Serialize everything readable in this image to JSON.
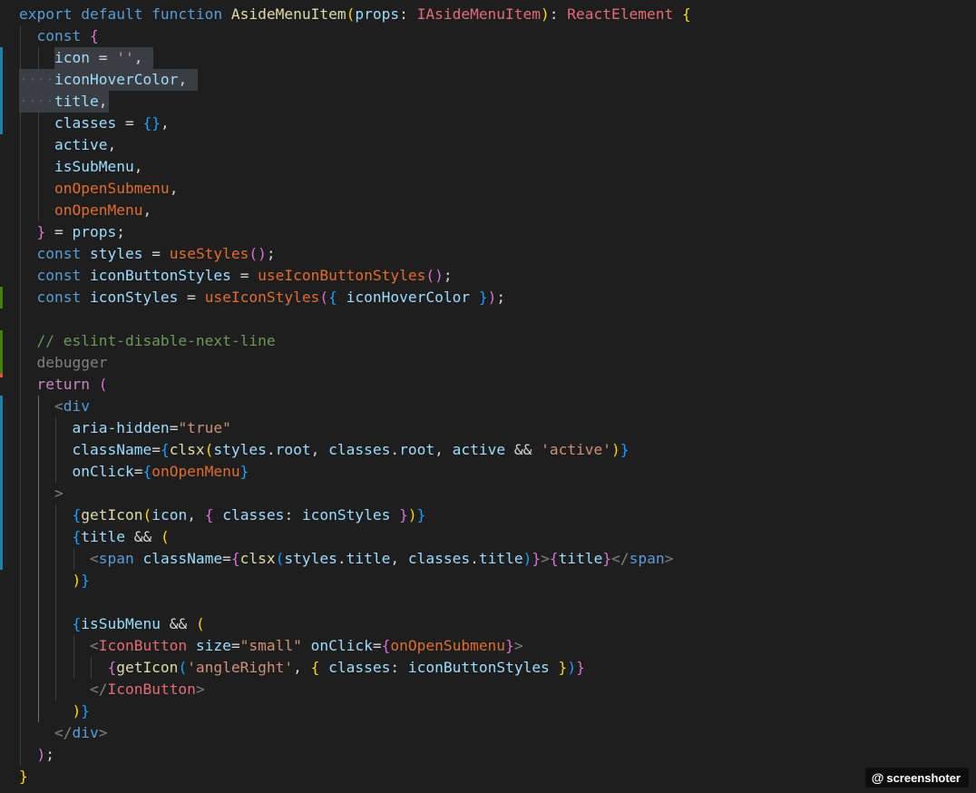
{
  "editor": {
    "background": "#1e1e1e",
    "theme_colors": {
      "keyword": "#569cd6",
      "control": "#c586c0",
      "function": "#dcdcaa",
      "function_alt": "#e06c2e",
      "variable": "#9cdcfe",
      "type": "#e06c75",
      "string": "#ce9178",
      "comment": "#6a9955",
      "punctuation": "#d4d4d4",
      "bracket_gold": "#ffd700",
      "bracket_pink": "#da70d6",
      "bracket_blue": "#179fff",
      "tag": "#808080",
      "component": "#4ec9b0",
      "inactive": "#808080"
    },
    "lines": [
      [
        [
          "export default function ",
          "keyword"
        ],
        [
          "AsideMenuItem",
          "function"
        ],
        [
          "(",
          "bracket_gold"
        ],
        [
          "props",
          "variable"
        ],
        [
          ": ",
          "punctuation"
        ],
        [
          "IAsideMenuItem",
          "type"
        ],
        [
          ")",
          "bracket_gold"
        ],
        [
          ": ",
          "punctuation"
        ],
        [
          "ReactElement",
          "type"
        ],
        [
          " {",
          "bracket_gold"
        ]
      ],
      [
        [
          "  const ",
          "keyword"
        ],
        [
          "{",
          "bracket_pink"
        ]
      ],
      [
        [
          "    icon",
          "variable"
        ],
        [
          " = ",
          "punctuation"
        ],
        [
          "''",
          "string"
        ],
        [
          ",",
          "punctuation"
        ]
      ],
      [
        [
          "    iconHoverColor",
          "variable"
        ],
        [
          ",",
          "punctuation"
        ]
      ],
      [
        [
          "    title",
          "variable"
        ],
        [
          ",",
          "punctuation"
        ]
      ],
      [
        [
          "    classes",
          "variable"
        ],
        [
          " = ",
          "punctuation"
        ],
        [
          "{}",
          "bracket_blue"
        ],
        [
          ",",
          "punctuation"
        ]
      ],
      [
        [
          "    active",
          "variable"
        ],
        [
          ",",
          "punctuation"
        ]
      ],
      [
        [
          "    isSubMenu",
          "variable"
        ],
        [
          ",",
          "punctuation"
        ]
      ],
      [
        [
          "    onOpenSubmenu",
          "function_alt"
        ],
        [
          ",",
          "punctuation"
        ]
      ],
      [
        [
          "    onOpenMenu",
          "function_alt"
        ],
        [
          ",",
          "punctuation"
        ]
      ],
      [
        [
          "  }",
          "bracket_pink"
        ],
        [
          " = ",
          "punctuation"
        ],
        [
          "props",
          "variable"
        ],
        [
          ";",
          "punctuation"
        ]
      ],
      [
        [
          "  const ",
          "keyword"
        ],
        [
          "styles",
          "variable"
        ],
        [
          " = ",
          "punctuation"
        ],
        [
          "useStyles",
          "function_alt"
        ],
        [
          "()",
          "bracket_pink"
        ],
        [
          ";",
          "punctuation"
        ]
      ],
      [
        [
          "  const ",
          "keyword"
        ],
        [
          "iconButtonStyles",
          "variable"
        ],
        [
          " = ",
          "punctuation"
        ],
        [
          "useIconButtonStyles",
          "function_alt"
        ],
        [
          "()",
          "bracket_pink"
        ],
        [
          ";",
          "punctuation"
        ]
      ],
      [
        [
          "  const ",
          "keyword"
        ],
        [
          "iconStyles",
          "variable"
        ],
        [
          " = ",
          "punctuation"
        ],
        [
          "useIconStyles",
          "function_alt"
        ],
        [
          "(",
          "bracket_pink"
        ],
        [
          "{ ",
          "bracket_blue"
        ],
        [
          "iconHoverColor",
          "variable"
        ],
        [
          " }",
          "bracket_blue"
        ],
        [
          ")",
          "bracket_pink"
        ],
        [
          ";",
          "punctuation"
        ]
      ],
      [],
      [
        [
          "  // eslint-disable-next-line",
          "comment"
        ]
      ],
      [
        [
          "  debugger",
          "inactive"
        ]
      ],
      [
        [
          "  return ",
          "control"
        ],
        [
          "(",
          "bracket_pink"
        ]
      ],
      [
        [
          "    <",
          "tag"
        ],
        [
          "div",
          "keyword"
        ]
      ],
      [
        [
          "      aria-hidden",
          "variable"
        ],
        [
          "=",
          "punctuation"
        ],
        [
          "\"true\"",
          "string"
        ]
      ],
      [
        [
          "      className",
          "variable"
        ],
        [
          "=",
          "punctuation"
        ],
        [
          "{",
          "bracket_blue"
        ],
        [
          "clsx",
          "function"
        ],
        [
          "(",
          "bracket_gold"
        ],
        [
          "styles",
          "variable"
        ],
        [
          ".",
          "punctuation"
        ],
        [
          "root",
          "variable"
        ],
        [
          ", ",
          "punctuation"
        ],
        [
          "classes",
          "variable"
        ],
        [
          ".",
          "punctuation"
        ],
        [
          "root",
          "variable"
        ],
        [
          ", ",
          "punctuation"
        ],
        [
          "active",
          "variable"
        ],
        [
          " && ",
          "punctuation"
        ],
        [
          "'active'",
          "string"
        ],
        [
          ")",
          "bracket_gold"
        ],
        [
          "}",
          "bracket_blue"
        ]
      ],
      [
        [
          "      onClick",
          "variable"
        ],
        [
          "=",
          "punctuation"
        ],
        [
          "{",
          "bracket_blue"
        ],
        [
          "onOpenMenu",
          "function_alt"
        ],
        [
          "}",
          "bracket_blue"
        ]
      ],
      [
        [
          "    >",
          "tag"
        ]
      ],
      [
        [
          "      {",
          "bracket_blue"
        ],
        [
          "getIcon",
          "function"
        ],
        [
          "(",
          "bracket_gold"
        ],
        [
          "icon",
          "variable"
        ],
        [
          ", ",
          "punctuation"
        ],
        [
          "{ ",
          "bracket_pink"
        ],
        [
          "classes",
          "variable"
        ],
        [
          ": ",
          "punctuation"
        ],
        [
          "iconStyles",
          "variable"
        ],
        [
          " }",
          "bracket_pink"
        ],
        [
          ")",
          "bracket_gold"
        ],
        [
          "}",
          "bracket_blue"
        ]
      ],
      [
        [
          "      {",
          "bracket_blue"
        ],
        [
          "title",
          "variable"
        ],
        [
          " && ",
          "punctuation"
        ],
        [
          "(",
          "bracket_gold"
        ]
      ],
      [
        [
          "        <",
          "tag"
        ],
        [
          "span ",
          "keyword"
        ],
        [
          "className",
          "variable"
        ],
        [
          "=",
          "punctuation"
        ],
        [
          "{",
          "bracket_pink"
        ],
        [
          "clsx",
          "function"
        ],
        [
          "(",
          "bracket_blue"
        ],
        [
          "styles",
          "variable"
        ],
        [
          ".",
          "punctuation"
        ],
        [
          "title",
          "variable"
        ],
        [
          ", ",
          "punctuation"
        ],
        [
          "classes",
          "variable"
        ],
        [
          ".",
          "punctuation"
        ],
        [
          "title",
          "variable"
        ],
        [
          ")",
          "bracket_blue"
        ],
        [
          "}",
          "bracket_pink"
        ],
        [
          ">",
          "tag"
        ],
        [
          "{",
          "bracket_pink"
        ],
        [
          "title",
          "variable"
        ],
        [
          "}",
          "bracket_pink"
        ],
        [
          "</",
          "tag"
        ],
        [
          "span",
          "keyword"
        ],
        [
          ">",
          "tag"
        ]
      ],
      [
        [
          "      )",
          "bracket_gold"
        ],
        [
          "}",
          "bracket_blue"
        ]
      ],
      [],
      [
        [
          "      {",
          "bracket_blue"
        ],
        [
          "isSubMenu",
          "variable"
        ],
        [
          " && ",
          "punctuation"
        ],
        [
          "(",
          "bracket_gold"
        ]
      ],
      [
        [
          "        <",
          "tag"
        ],
        [
          "IconButton ",
          "type"
        ],
        [
          "size",
          "variable"
        ],
        [
          "=",
          "punctuation"
        ],
        [
          "\"small\" ",
          "string"
        ],
        [
          "onClick",
          "variable"
        ],
        [
          "=",
          "punctuation"
        ],
        [
          "{",
          "bracket_pink"
        ],
        [
          "onOpenSubmenu",
          "function_alt"
        ],
        [
          "}",
          "bracket_pink"
        ],
        [
          ">",
          "tag"
        ]
      ],
      [
        [
          "          {",
          "bracket_pink"
        ],
        [
          "getIcon",
          "function"
        ],
        [
          "(",
          "bracket_blue"
        ],
        [
          "'angleRight'",
          "string"
        ],
        [
          ", ",
          "punctuation"
        ],
        [
          "{ ",
          "bracket_gold"
        ],
        [
          "classes",
          "variable"
        ],
        [
          ": ",
          "punctuation"
        ],
        [
          "iconButtonStyles",
          "variable"
        ],
        [
          " }",
          "bracket_gold"
        ],
        [
          ")",
          "bracket_blue"
        ],
        [
          "}",
          "bracket_pink"
        ]
      ],
      [
        [
          "        </",
          "tag"
        ],
        [
          "IconButton",
          "type"
        ],
        [
          ">",
          "tag"
        ]
      ],
      [
        [
          "      )",
          "bracket_gold"
        ],
        [
          "}",
          "bracket_blue"
        ]
      ],
      [
        [
          "    </",
          "tag"
        ],
        [
          "div",
          "keyword"
        ],
        [
          ">",
          "tag"
        ]
      ],
      [
        [
          "  )",
          "bracket_pink"
        ],
        [
          ";",
          "punctuation"
        ]
      ],
      [
        [
          "}",
          "bracket_gold"
        ]
      ]
    ]
  },
  "badge": {
    "at_symbol": "@",
    "label": "screenshoter"
  }
}
